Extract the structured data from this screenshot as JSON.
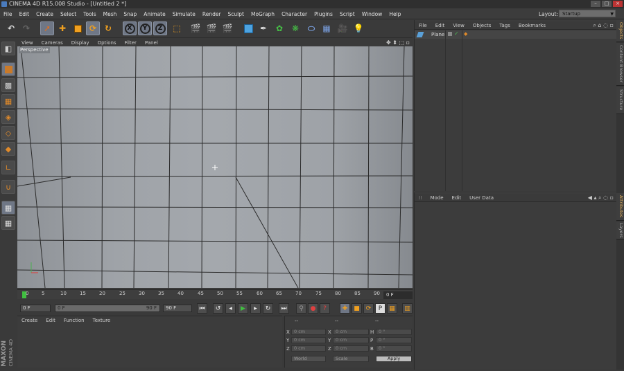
{
  "titlebar": {
    "title": "CINEMA 4D R15.008 Studio - [Untitled 2 *]",
    "min": "–",
    "max": "□",
    "close": "×"
  },
  "menu": [
    "File",
    "Edit",
    "Create",
    "Select",
    "Tools",
    "Mesh",
    "Snap",
    "Animate",
    "Simulate",
    "Render",
    "Sculpt",
    "MoGraph",
    "Character",
    "Plugins",
    "Script",
    "Window",
    "Help"
  ],
  "layout": {
    "label": "Layout:",
    "value": "Startup"
  },
  "toolbar": {
    "axis_x": "X",
    "axis_y": "Y",
    "axis_z": "Z"
  },
  "viewport": {
    "menu": [
      "View",
      "Cameras",
      "Display",
      "Options",
      "Filter",
      "Panel"
    ],
    "label": "Perspective"
  },
  "timeline": {
    "ticks": [
      "0",
      "5",
      "10",
      "15",
      "20",
      "25",
      "30",
      "35",
      "40",
      "45",
      "50",
      "55",
      "60",
      "65",
      "70",
      "75",
      "80",
      "85",
      "90"
    ],
    "end_frame": "0 F"
  },
  "transport": {
    "current": "0 F",
    "range_start": "0 F",
    "range_end": "90 F",
    "max": "90 F"
  },
  "material_manager": {
    "menu": [
      "Create",
      "Edit",
      "Function",
      "Texture"
    ]
  },
  "coordinates": {
    "headers": [
      "--",
      "--",
      "--"
    ],
    "rows": [
      {
        "a": "X",
        "av": "0 cm",
        "b": "X",
        "bv": "0 cm",
        "c": "H",
        "cv": "0 °"
      },
      {
        "a": "Y",
        "av": "0 cm",
        "b": "Y",
        "bv": "0 cm",
        "c": "P",
        "cv": "0 °"
      },
      {
        "a": "Z",
        "av": "0 cm",
        "b": "Z",
        "bv": "0 cm",
        "c": "B",
        "cv": "0 °"
      }
    ],
    "world": "World",
    "scale": "Scale",
    "apply": "Apply"
  },
  "objects_panel": {
    "menu": [
      "File",
      "Edit",
      "View",
      "Objects",
      "Tags",
      "Bookmarks"
    ],
    "object_name": "Plane"
  },
  "attributes_panel": {
    "menu": [
      "Mode",
      "Edit",
      "User Data"
    ]
  },
  "side_tabs": {
    "objects": "Objects",
    "content_browser": "Content Browser",
    "structure": "Structure",
    "attributes": "Attributes",
    "layers": "Layers"
  },
  "logo": {
    "brand": "MAXON",
    "product": "CINEMA 4D"
  }
}
